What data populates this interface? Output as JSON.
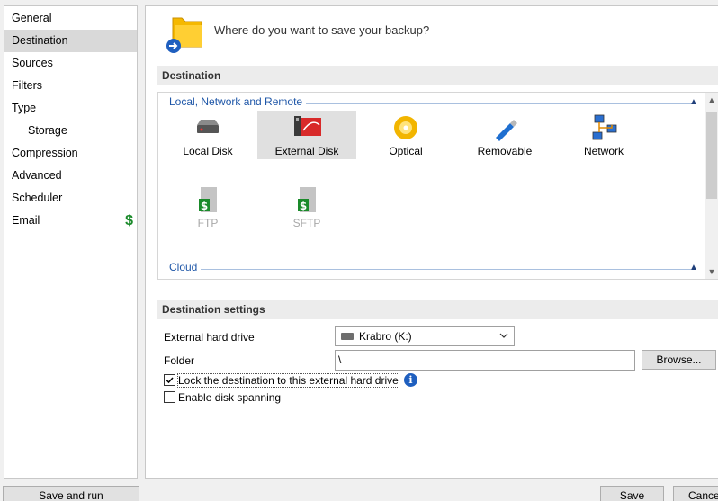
{
  "sidebar": {
    "items": [
      {
        "label": "General"
      },
      {
        "label": "Destination"
      },
      {
        "label": "Sources"
      },
      {
        "label": "Filters"
      },
      {
        "label": "Type"
      },
      {
        "label": "Storage"
      },
      {
        "label": "Compression"
      },
      {
        "label": "Advanced"
      },
      {
        "label": "Scheduler"
      },
      {
        "label": "Email"
      }
    ],
    "active": "Destination",
    "email_badge": "$"
  },
  "header": {
    "prompt": "Where do you want to save your backup?"
  },
  "destination": {
    "section_title": "Destination",
    "groups": [
      {
        "title": "Local, Network and Remote"
      },
      {
        "title": "Cloud"
      }
    ],
    "tiles": [
      {
        "label": "Local Disk"
      },
      {
        "label": "External Disk"
      },
      {
        "label": "Optical"
      },
      {
        "label": "Removable"
      },
      {
        "label": "Network"
      },
      {
        "label": "FTP"
      },
      {
        "label": "SFTP"
      }
    ],
    "selected": "External Disk"
  },
  "settings": {
    "section_title": "Destination settings",
    "drive_label": "External hard drive",
    "drive_value": "Krabro (K:)",
    "folder_label": "Folder",
    "folder_value": "\\",
    "browse_label": "Browse...",
    "lock_label": "Lock the destination to this external hard drive",
    "lock_checked": true,
    "spanning_label": "Enable disk spanning",
    "spanning_checked": false
  },
  "footer": {
    "save_and_run": "Save and run",
    "save": "Save",
    "cancel": "Cance"
  },
  "colors": {
    "accent_blue": "#1f57a8",
    "money_green": "#1a8a2a",
    "selected_bg": "#e0e0e0"
  }
}
